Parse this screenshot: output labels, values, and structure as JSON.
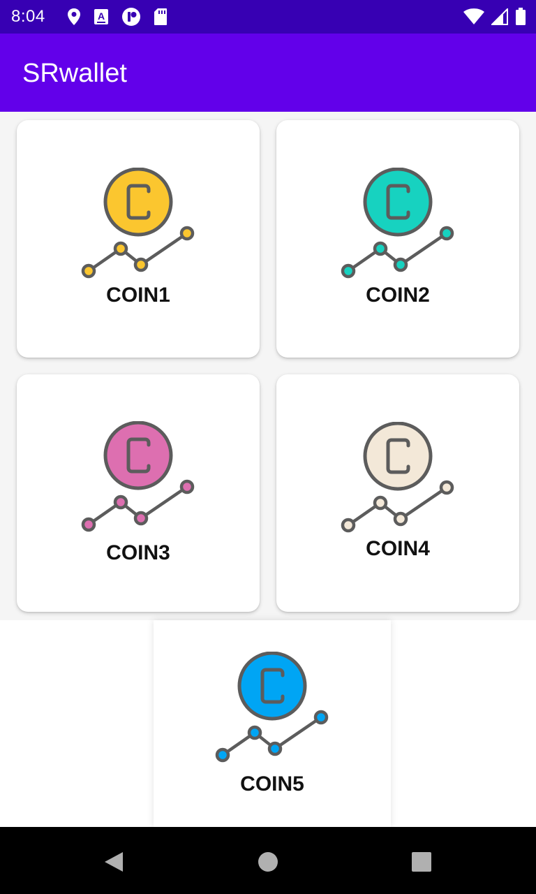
{
  "status_bar": {
    "time": "8:04",
    "left_icons": [
      "location-icon",
      "keyboard-a-icon",
      "profile-badge-icon",
      "sd-card-icon"
    ],
    "right_icons": [
      "wifi-icon",
      "signal-icon",
      "battery-icon"
    ]
  },
  "app_bar": {
    "title": "SRwallet"
  },
  "coins": [
    {
      "label": "COIN1",
      "color": "#fbc62f"
    },
    {
      "label": "COIN2",
      "color": "#17d2c0"
    },
    {
      "label": "COIN3",
      "color": "#dd6fb0"
    },
    {
      "label": "COIN4",
      "color": "#f3e8d8"
    },
    {
      "label": "COIN5",
      "color": "#00a5f4"
    }
  ],
  "nav_bar": {
    "back": "back-icon",
    "home": "home-icon",
    "recents": "recents-icon"
  }
}
